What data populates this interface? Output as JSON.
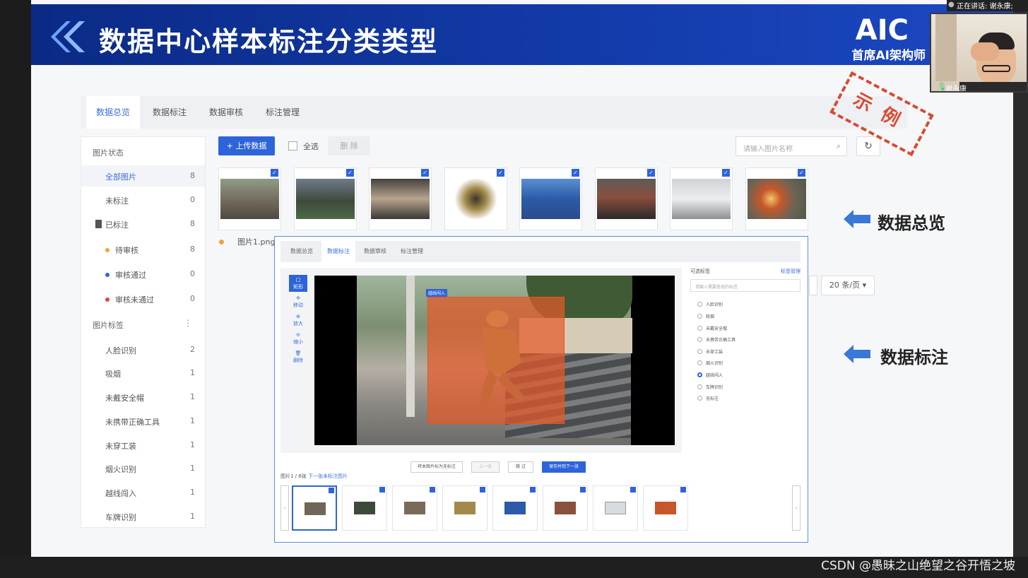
{
  "meeting": {
    "speaking_label": "正在讲话: 谢永康;",
    "participant_name": "谢永康"
  },
  "banner": {
    "title": "数据中心样本标注分类类型",
    "brand": "AIC",
    "brand_sub": "首席AI架构师"
  },
  "app": {
    "tabs": [
      "数据总览",
      "数据标注",
      "数据审核",
      "标注管理"
    ],
    "active_tab": 0,
    "toolbar": {
      "upload_label": "上传数据",
      "select_all_label": "全选",
      "delete_label": "删 除",
      "search_placeholder": "请输入图片名称"
    },
    "sidebar": {
      "status_title": "图片状态",
      "status_items": [
        {
          "label": "全部图片",
          "count": "8",
          "active": true
        },
        {
          "label": "未标注",
          "count": "0"
        },
        {
          "label": "已标注",
          "count": "8"
        },
        {
          "label": "待审核",
          "count": "8",
          "color": "#f0a43a"
        },
        {
          "label": "审核通过",
          "count": "0",
          "color": "#2e64d9"
        },
        {
          "label": "审核未通过",
          "count": "0",
          "color": "#e0463a"
        }
      ],
      "tags_title": "图片标签",
      "tag_items": [
        {
          "label": "人脸识别",
          "count": "2"
        },
        {
          "label": "吸烟",
          "count": "1"
        },
        {
          "label": "未戴安全帽",
          "count": "1"
        },
        {
          "label": "未携带正确工具",
          "count": "1"
        },
        {
          "label": "未穿工装",
          "count": "1"
        },
        {
          "label": "烟火识别",
          "count": "1"
        },
        {
          "label": "越线闯入",
          "count": "1"
        },
        {
          "label": "车牌识别",
          "count": "1"
        }
      ]
    },
    "file_label": "图片1.png",
    "pager_label": "20 条/页"
  },
  "annot": {
    "tabs": [
      "数据总览",
      "数据标注",
      "数据审核",
      "标注管理"
    ],
    "active_tab": 1,
    "tools": [
      "矩形",
      "移动",
      "放大",
      "缩小",
      "删除"
    ],
    "bbox_label": "越线闯入",
    "label_panel_title": "可选标签",
    "label_panel_manage": "标签管理",
    "label_search_placeholder": "请输入需要查找的标签",
    "labels": [
      "人脸识别",
      "吸烟",
      "未戴安全帽",
      "未携带正确工具",
      "未穿工装",
      "烟火识别",
      "越线闯入",
      "车牌识别",
      "无标注"
    ],
    "selected_label_index": 6,
    "actions": {
      "mark_none": "将本图片标为无标注",
      "prev": "上一张",
      "skip": "跳 过",
      "save_next": "保存并到下一张"
    },
    "nav_text": "图片1 / 8张",
    "nav_next": "下一张未标注图片"
  },
  "side_notes": {
    "overview": "数据总览",
    "annotation": "数据标注"
  },
  "stamp_text": "示例",
  "watermark": "CSDN @愚昧之山绝望之谷开悟之坡",
  "colors": {
    "primary": "#2e64d9",
    "banner": "#123aa8",
    "bbox": "#e65a28",
    "stamp": "#d74b32"
  }
}
